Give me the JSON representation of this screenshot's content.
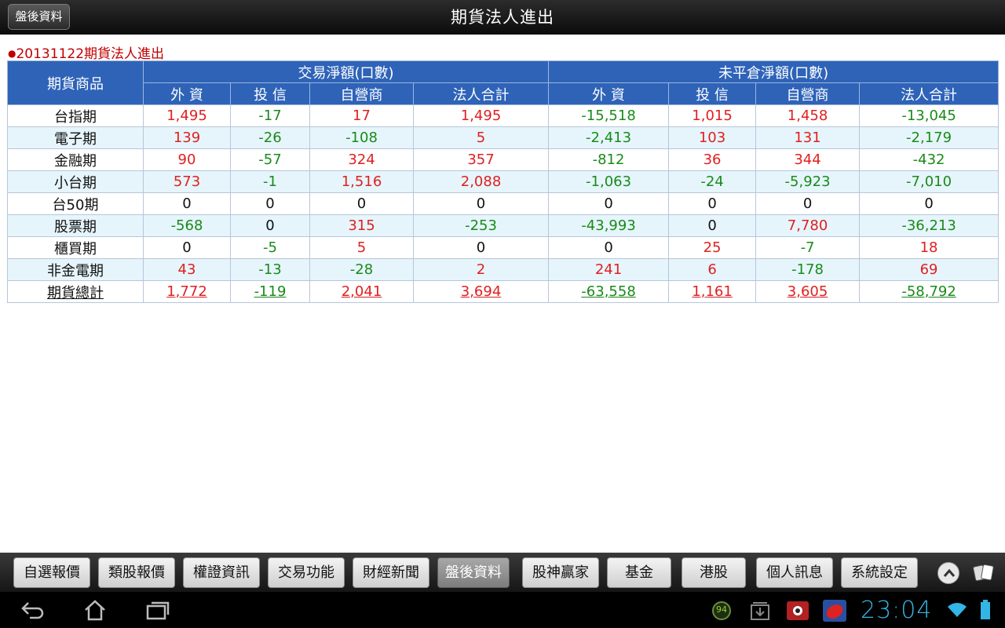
{
  "titlebar": {
    "back_label": "盤後資料",
    "title": "期貨法人進出"
  },
  "report": {
    "date_label": "20131122期貨法人進出"
  },
  "table": {
    "product_header": "期貨商品",
    "group_headers": [
      "交易淨額(口數)",
      "未平倉淨額(口數)"
    ],
    "sub_headers": [
      "外 資",
      "投 信",
      "自營商",
      "法人合計",
      "外 資",
      "投 信",
      "自營商",
      "法人合計"
    ],
    "rows": [
      {
        "name": "台指期",
        "values": [
          "1,495",
          "-17",
          "17",
          "1,495",
          "-15,518",
          "1,015",
          "1,458",
          "-13,045"
        ]
      },
      {
        "name": "電子期",
        "values": [
          "139",
          "-26",
          "-108",
          "5",
          "-2,413",
          "103",
          "131",
          "-2,179"
        ]
      },
      {
        "name": "金融期",
        "values": [
          "90",
          "-57",
          "324",
          "357",
          "-812",
          "36",
          "344",
          "-432"
        ]
      },
      {
        "name": "小台期",
        "values": [
          "573",
          "-1",
          "1,516",
          "2,088",
          "-1,063",
          "-24",
          "-5,923",
          "-7,010"
        ]
      },
      {
        "name": "台50期",
        "values": [
          "0",
          "0",
          "0",
          "0",
          "0",
          "0",
          "0",
          "0"
        ]
      },
      {
        "name": "股票期",
        "values": [
          "-568",
          "0",
          "315",
          "-253",
          "-43,993",
          "0",
          "7,780",
          "-36,213"
        ]
      },
      {
        "name": "櫃買期",
        "values": [
          "0",
          "-5",
          "5",
          "0",
          "0",
          "25",
          "-7",
          "18"
        ]
      },
      {
        "name": "非金電期",
        "values": [
          "43",
          "-13",
          "-28",
          "2",
          "241",
          "6",
          "-178",
          "69"
        ]
      }
    ],
    "total": {
      "name": "期貨總計",
      "values": [
        "1,772",
        "-119",
        "2,041",
        "3,694",
        "-63,558",
        "1,161",
        "3,605",
        "-58,792"
      ]
    }
  },
  "tabs": [
    {
      "label": "自選報價",
      "active": false
    },
    {
      "label": "類股報價",
      "active": false
    },
    {
      "label": "權證資訊",
      "active": false
    },
    {
      "label": "交易功能",
      "active": false
    },
    {
      "label": "財經新聞",
      "active": false
    },
    {
      "label": "盤後資料",
      "active": true
    },
    {
      "label": "股神贏家",
      "active": false
    },
    {
      "label": "基金",
      "active": false
    },
    {
      "label": "港股",
      "active": false
    },
    {
      "label": "個人訊息",
      "active": false
    },
    {
      "label": "系統設定",
      "active": false
    }
  ],
  "statusbar": {
    "clock": "23:04",
    "badge": "94"
  },
  "colors": {
    "header_blue": "#2e63b8",
    "positive": "#e02020",
    "negative": "#1a8a1a",
    "alt_row": "#e6f5fb",
    "clock": "#33b5e5"
  },
  "icons": [
    "back-arrow-icon",
    "home-icon",
    "recent-apps-icon",
    "chevron-up-icon",
    "cards-icon",
    "download-icon",
    "app-icon",
    "wifi-icon",
    "battery-icon"
  ]
}
